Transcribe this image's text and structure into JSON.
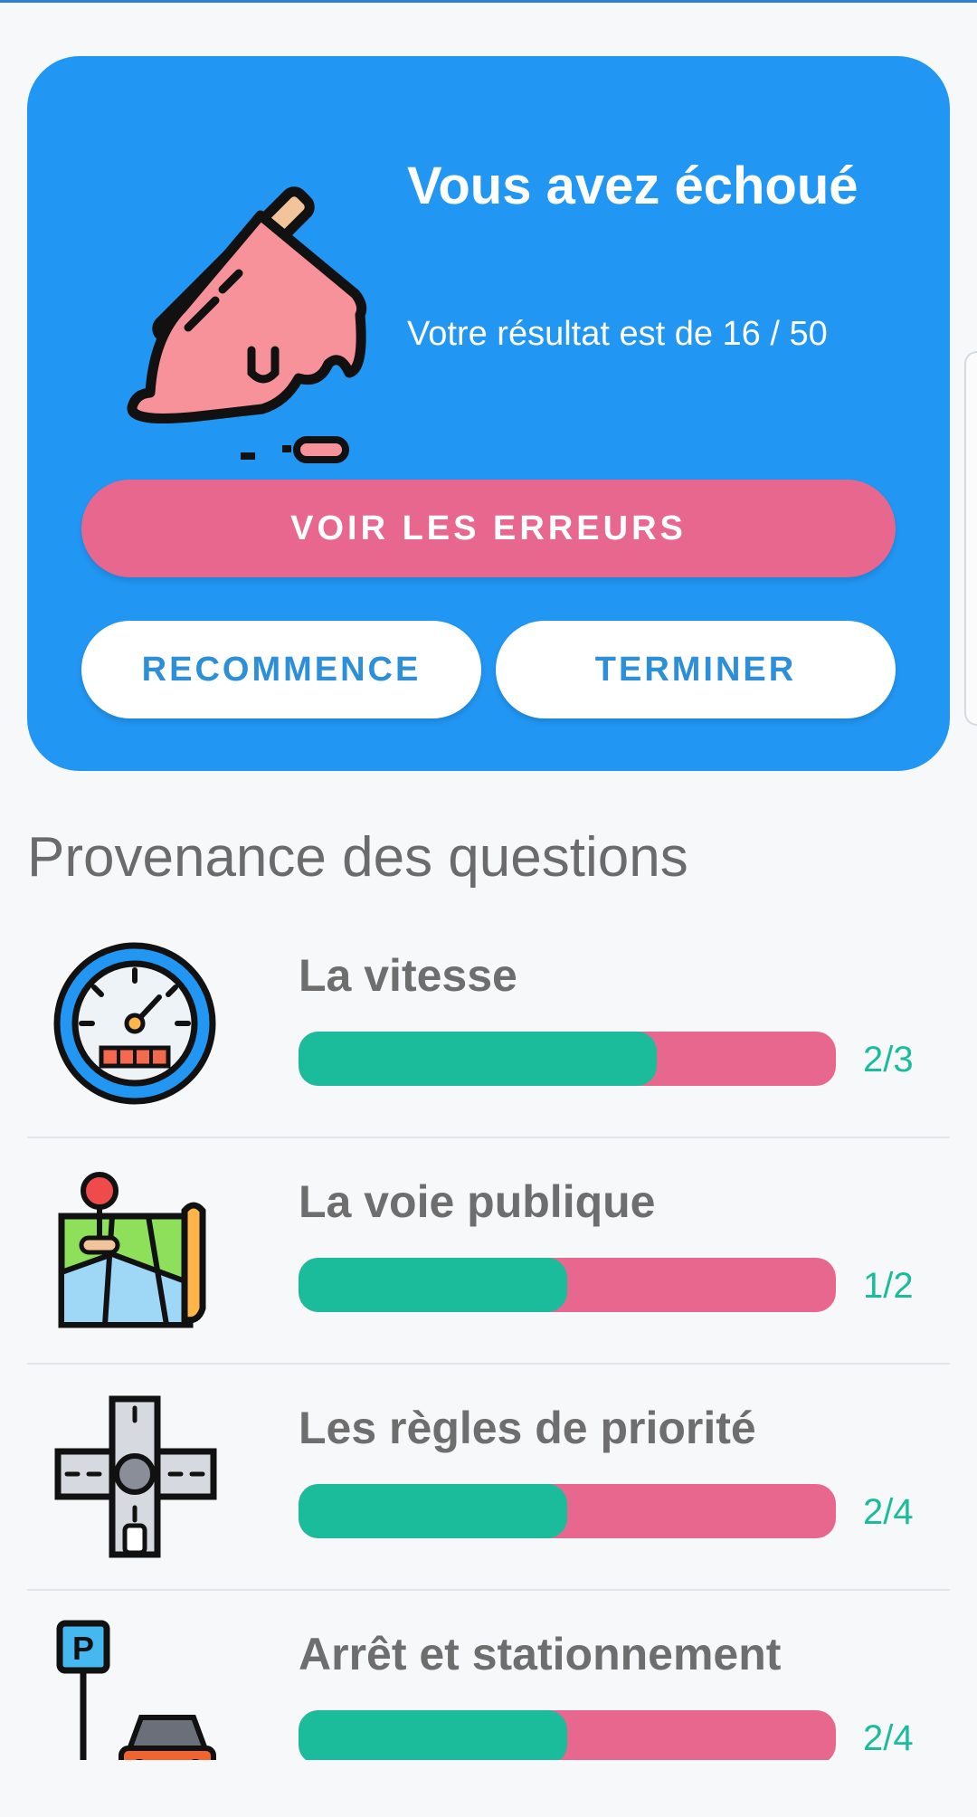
{
  "result": {
    "title": "Vous avez échoué",
    "subtitle": "Votre résultat est de 16 / 50",
    "score": 16,
    "total": 50
  },
  "buttons": {
    "see_errors": "VOIR LES ERREURS",
    "restart": "RECOMMENCE",
    "finish": "TERMINER"
  },
  "section": {
    "title": "Provenance des questions"
  },
  "categories": [
    {
      "name": "La vitesse",
      "score": "2/3",
      "correct": 2,
      "total": 3,
      "fraction": 0.6667,
      "icon": "speedometer-icon"
    },
    {
      "name": "La voie publique",
      "score": "1/2",
      "correct": 1,
      "total": 2,
      "fraction": 0.5,
      "icon": "road-map-icon"
    },
    {
      "name": "Les règles de priorité",
      "score": "2/4",
      "correct": 2,
      "total": 4,
      "fraction": 0.5,
      "icon": "roundabout-icon"
    },
    {
      "name": "Arrêt et stationnement",
      "score": "2/4",
      "correct": 2,
      "total": 4,
      "fraction": 0.5,
      "icon": "parking-icon"
    }
  ],
  "colors": {
    "card": "#2196f3",
    "error_button": "#e8678f",
    "correct": "#1bbc9b",
    "wrong": "#e8678f",
    "white_button_text": "#2c8fd8"
  }
}
